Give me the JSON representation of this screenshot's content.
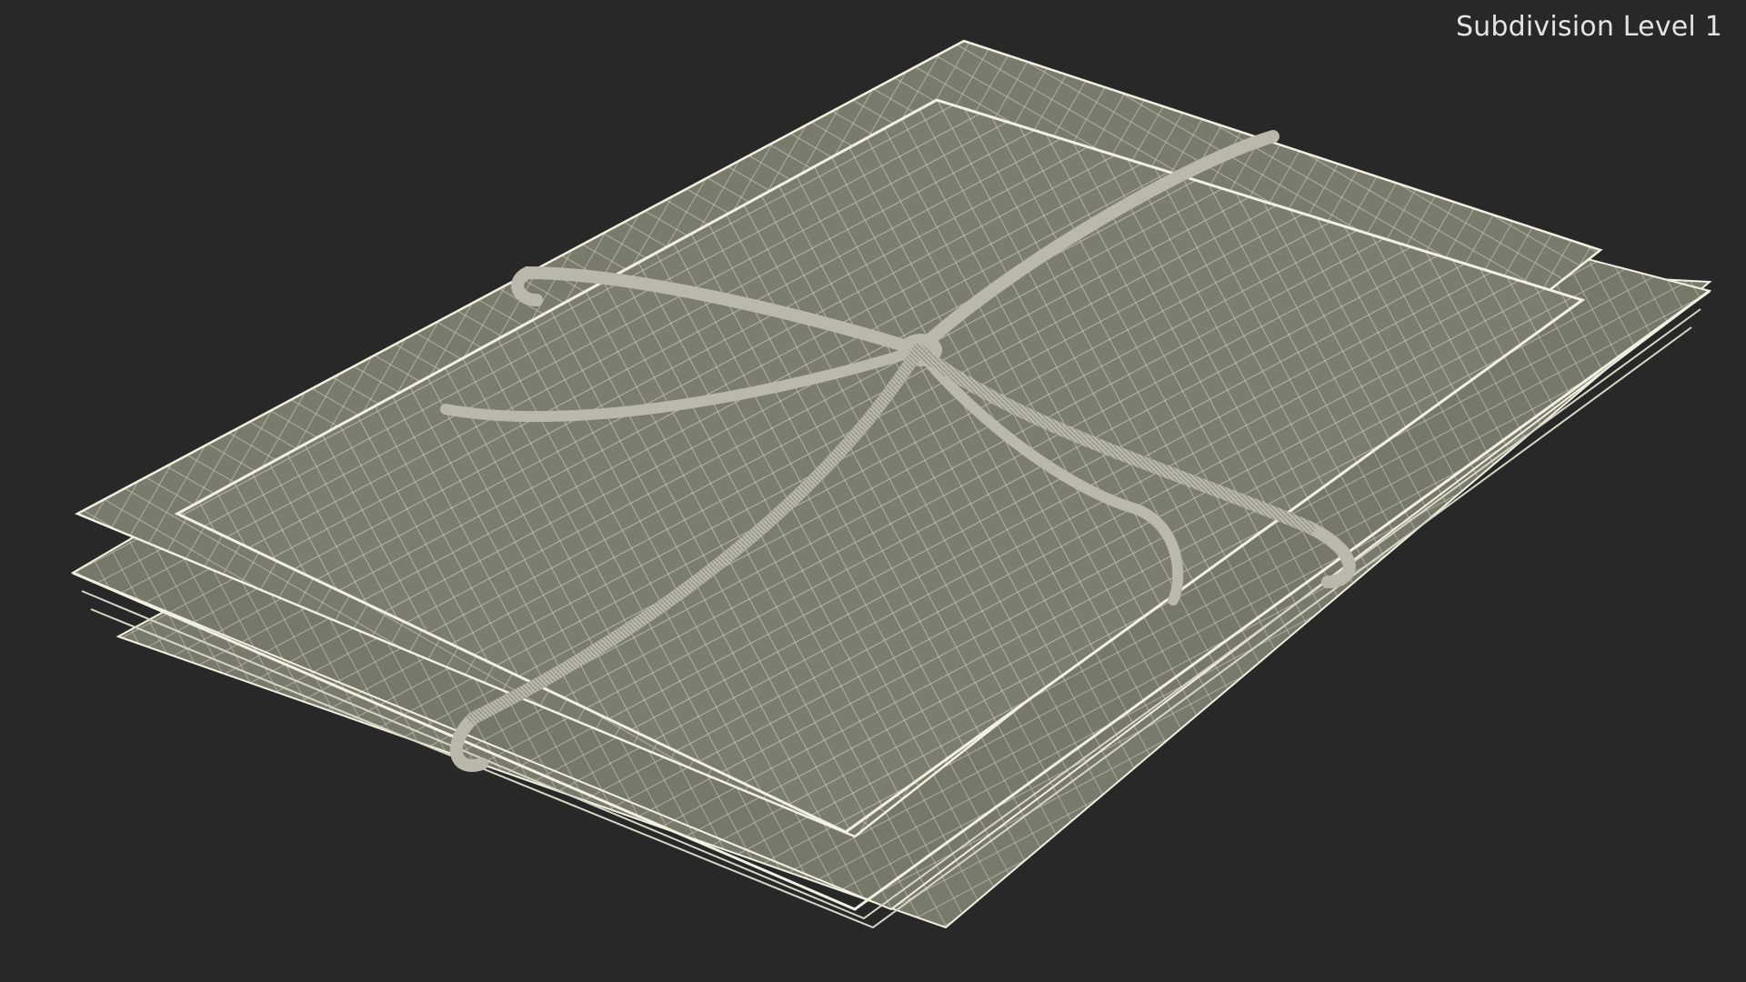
{
  "viewport": {
    "overlay_label": "Subdivision Level 1",
    "background_color": "#282828"
  },
  "model": {
    "surface_color": "#7a7a6c",
    "wire_color": "#f2f0e0",
    "string_color": "#b9b8ab"
  }
}
